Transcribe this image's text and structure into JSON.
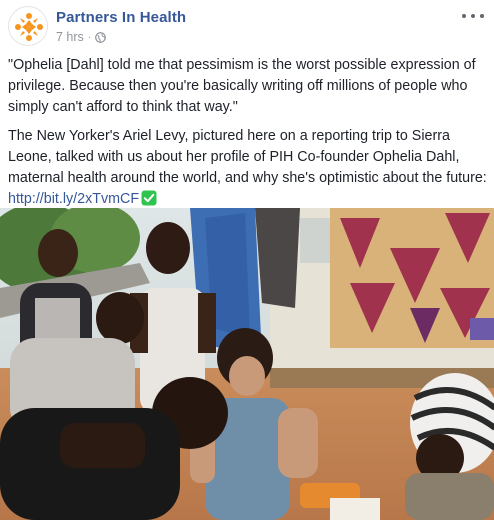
{
  "post": {
    "page_name": "Partners In Health",
    "timestamp": "7 hrs",
    "separator": "·",
    "audience_icon": "globe-icon",
    "more_icon": "more-options-icon",
    "quote": "\"Ophelia [Dahl] told me that pessimism is the worst possible expression of privilege. Because then you're basically writing off millions of people who simply can't afford to think that way.\"",
    "description": "The New Yorker's Ariel Levy, pictured here on a reporting trip to Sierra Leone, talked with us about her profile of PIH Co-founder Ophelia Dahl, maternal health around the world, and why she's optimistic about the future:",
    "link_text": "http://bit.ly/2xTvmCF",
    "link_badge_icon": "check-mark-icon",
    "colors": {
      "page_name": "#365899",
      "meta": "#90949c",
      "brand_orange": "#f7941d",
      "check_green": "#2ec44f"
    }
  }
}
